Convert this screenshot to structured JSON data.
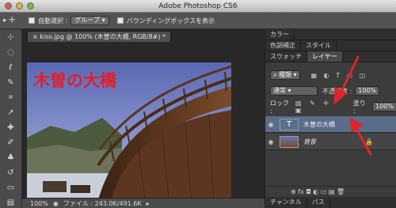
{
  "window": {
    "title": "Adobe Photoshop CS6"
  },
  "options_bar": {
    "tool_glyph": "▸ ✢",
    "auto_select_label": "自動選択 :",
    "auto_select_value": "グループ",
    "bbox_label": "バウンディングボックスを表示"
  },
  "document": {
    "tab_title": "kiso.jpg @ 100% (木曽の大橋, RGB/8#) *",
    "zoom": "100%",
    "file_info": "ファイル : 243.0K/491.6K",
    "overlay_text": "木曽の大橋"
  },
  "panels": {
    "row1_tabs": [
      "カラー"
    ],
    "row2_tabs": [
      "色調補正",
      "スタイル"
    ],
    "row3_tabs": [
      "スウォッチ",
      "レイヤー"
    ],
    "filter_label": "種類",
    "blend_mode": "通常",
    "opacity_label": "不透明度 :",
    "opacity_value": "100%",
    "lock_label": "ロック :",
    "fill_label": "塗り :",
    "fill_value": "100%",
    "layers": [
      {
        "name": "木曽の大橋",
        "type": "text"
      },
      {
        "name": "背景",
        "type": "image"
      }
    ],
    "bottom_icons": "⊕ fx ◘ ◐ ▭ ▤ 🗑",
    "bottom_tabs": [
      "チャンネル",
      "パス"
    ]
  },
  "colors": {
    "annotation": "#e0242b",
    "selected_layer": "#5a6d8a",
    "overlay_text": "#e01f2a"
  }
}
